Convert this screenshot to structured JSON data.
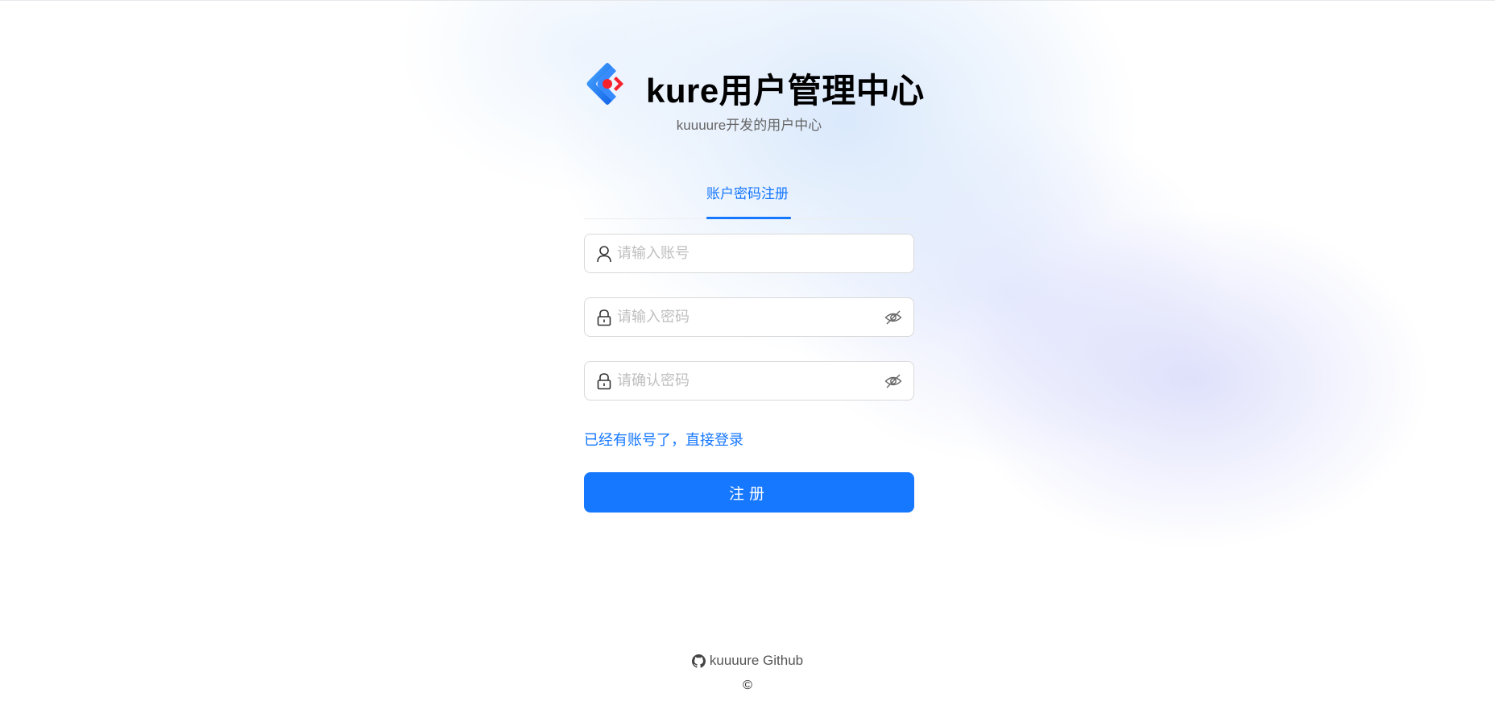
{
  "app": {
    "title": "kure用户管理中心",
    "subtitle": "kuuuure开发的用户中心"
  },
  "tabs": [
    {
      "label": "账户密码注册",
      "active": true
    }
  ],
  "form": {
    "account": {
      "placeholder": "请输入账号",
      "value": "",
      "icon": "user-icon"
    },
    "password": {
      "placeholder": "请输入密码",
      "value": "",
      "icon": "lock-icon",
      "toggle_icon": "eye-invisible-icon"
    },
    "confirm_password": {
      "placeholder": "请确认密码",
      "value": "",
      "icon": "lock-icon",
      "toggle_icon": "eye-invisible-icon"
    },
    "login_link": "已经有账号了，直接登录",
    "submit_label": "注册"
  },
  "footer": {
    "github_label": "kuuuure Github",
    "github_icon": "github-icon",
    "copyright_symbol": "©"
  },
  "colors": {
    "primary": "#1677ff",
    "logo_blue": "#1677ff",
    "logo_red": "#f5222d"
  }
}
